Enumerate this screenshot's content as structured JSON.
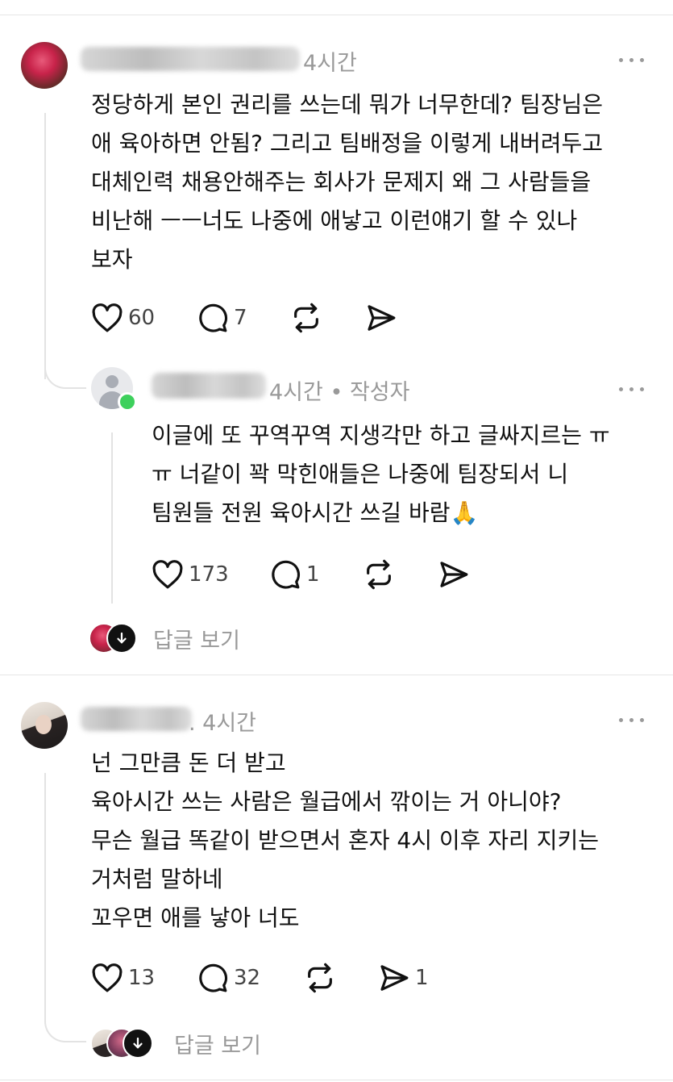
{
  "comments": [
    {
      "time": "4시간",
      "text": "정당하게 본인 권리를 쓰는데 뭐가 너무한데? 팀장님은\n애 육아하면 안됨? 그리고 팀배정을 이렇게 내버려두고\n대체인력 채용안해주는 회사가 문제지 왜 그 사람들을\n비난해 ㅡㅡ너도 나중에 애낳고 이런얘기 할 수 있나\n보자",
      "likes": "60",
      "replies": "7",
      "reply": {
        "time": "4시간 • 작성자",
        "text": "이글에 또 꾸역꾸역 지생각만 하고 글싸지르는 ㅠ\nㅠ 너같이 꽉 막힌애들은 나중에 팀장되서 니\n팀원들 전원 육아시간 쓰길 바람🙏",
        "likes": "173",
        "replies": "1"
      },
      "view_replies": "답글 보기"
    },
    {
      "time": ". 4시간",
      "text": "넌 그만큼 돈 더 받고\n육아시간 쓰는 사람은 월급에서 깎이는 거 아니야?\n무슨 월급 똑같이 받으면서 혼자 4시 이후 자리 지키는\n거처럼 말하네\n꼬우면 애를 낳아 너도",
      "likes": "13",
      "replies": "32",
      "shares": "1",
      "view_replies": "답글 보기"
    }
  ],
  "icons": [
    "heart-icon",
    "comment-icon",
    "repost-icon",
    "share-icon",
    "more-icon",
    "down-arrow-icon"
  ],
  "colors": {
    "online": "#3dd05c",
    "meta": "#999999"
  }
}
